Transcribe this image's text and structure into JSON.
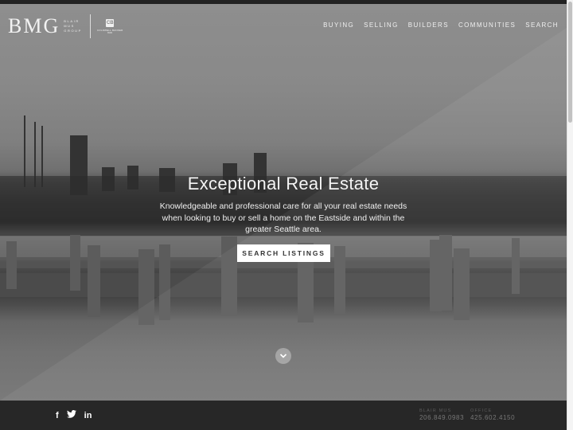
{
  "header": {
    "logo": {
      "mark": "BMG",
      "subtitle_lines": [
        "BLAIR",
        "MUS",
        "GROUP"
      ],
      "partner_icon": "coldwell-banker-icon",
      "partner_line1": "COLDWELL BANKER",
      "partner_line2": "BAIN"
    },
    "nav": [
      {
        "label": "BUYING"
      },
      {
        "label": "SELLING"
      },
      {
        "label": "BUILDERS"
      },
      {
        "label": "COMMUNITIES"
      },
      {
        "label": "SEARCH"
      }
    ]
  },
  "hero": {
    "title": "Exceptional Real Estate",
    "subtitle": "Knowledgeable and professional care for all your real estate needs when looking to buy or sell a home on the Eastside and within the greater Seattle area.",
    "cta_label": "SEARCH LISTINGS",
    "scroll_icon": "chevron-down-icon"
  },
  "footer": {
    "social": [
      {
        "icon": "facebook-icon",
        "glyph": "f"
      },
      {
        "icon": "twitter-icon",
        "glyph": "🐦"
      },
      {
        "icon": "linkedin-icon",
        "glyph": "in"
      }
    ],
    "contacts": [
      {
        "label": "BLAIR MUS",
        "value": "206.849.0983"
      },
      {
        "label": "OFFICE",
        "value": "425.602.4150"
      }
    ]
  }
}
